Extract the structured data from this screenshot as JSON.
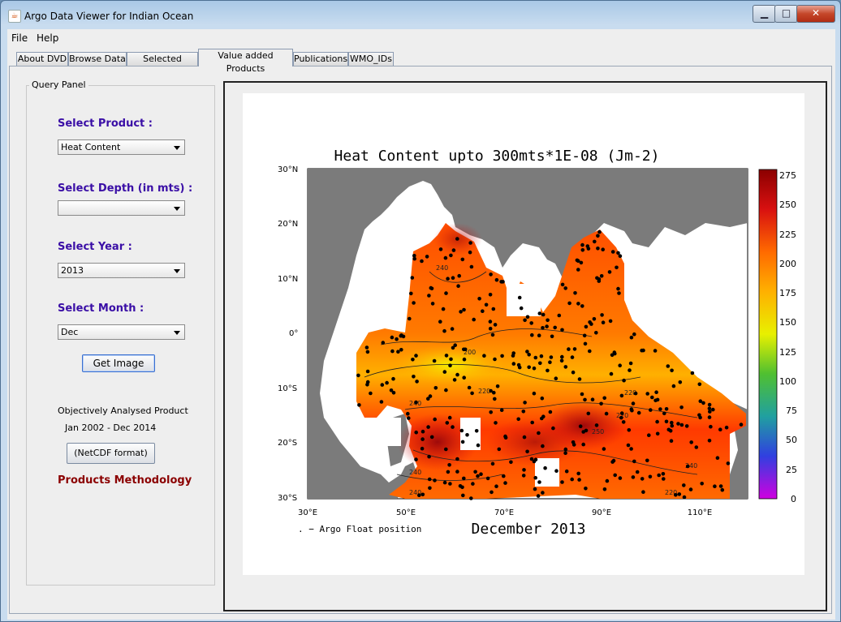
{
  "window": {
    "title": "Argo Data Viewer for Indian Ocean",
    "controls": {
      "minimize": "▁",
      "maximize": "□",
      "close": "✕"
    }
  },
  "menu": {
    "items": [
      "File",
      "Help"
    ]
  },
  "tabs": {
    "items": [
      "About DVD",
      "Browse Data",
      "Selected Profiles",
      "Value added Products",
      "Publications",
      "WMO_IDs"
    ],
    "active": "Value added Products"
  },
  "query_panel": {
    "title": "Query Panel",
    "product": {
      "label": "Select Product :",
      "value": "Heat Content"
    },
    "depth": {
      "label": "Select Depth (in mts) :",
      "value": ""
    },
    "year": {
      "label": "Select Year :",
      "value": "2013"
    },
    "month": {
      "label": "Select Month :",
      "value": "Dec"
    },
    "get_image_label": "Get Image",
    "product_note": "Objectively Analysed Product",
    "date_range": "Jan 2002 - Dec 2014",
    "netcdf_label": "(NetCDF format)",
    "methodology_label": "Products Methodology"
  },
  "map": {
    "title": "Heat Content upto 300mts*1E-08 (Jm-2)",
    "subtitle": "December 2013",
    "legend_note": ". − Argo Float position",
    "lat_labels": [
      "30°N",
      "20°N",
      "10°N",
      "0°",
      "10°S",
      "20°S",
      "30°S"
    ],
    "lon_labels": [
      "30°E",
      "50°E",
      "70°E",
      "90°E",
      "110°E"
    ],
    "colorbar_labels": [
      "275",
      "250",
      "225",
      "200",
      "175",
      "150",
      "125",
      "100",
      "75",
      "50",
      "25",
      "0"
    ],
    "contour_labels": [
      "240",
      "200",
      "220",
      "240",
      "220",
      "240",
      "240",
      "220",
      "220",
      "240",
      "250"
    ],
    "colors": {
      "land": "#7b7b7b",
      "high": "#b31212",
      "mid": "#ff5a00",
      "low": "#ffd500",
      "float": "#000000"
    }
  }
}
